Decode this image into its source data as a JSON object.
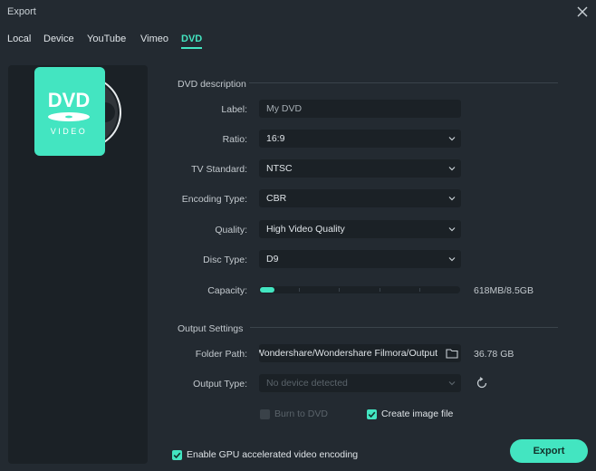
{
  "window": {
    "title": "Export"
  },
  "tabs": [
    {
      "label": "Local"
    },
    {
      "label": "Device"
    },
    {
      "label": "YouTube"
    },
    {
      "label": "Vimeo"
    },
    {
      "label": "DVD"
    }
  ],
  "active_tab": "DVD",
  "preview": {
    "logo_text": "DVD",
    "logo_subtext": "VIDEO"
  },
  "dvd_description": {
    "title": "DVD description",
    "label": {
      "label": "Label:",
      "value": "My DVD"
    },
    "ratio": {
      "label": "Ratio:",
      "value": "16:9"
    },
    "tv_standard": {
      "label": "TV Standard:",
      "value": "NTSC"
    },
    "encoding_type": {
      "label": "Encoding Type:",
      "value": "CBR"
    },
    "quality": {
      "label": "Quality:",
      "value": "High Video Quality"
    },
    "disc_type": {
      "label": "Disc Type:",
      "value": "D9"
    },
    "capacity": {
      "label": "Capacity:",
      "text": "618MB/8.5GB",
      "used_fraction": 0.071
    }
  },
  "output_settings": {
    "title": "Output Settings",
    "folder_path": {
      "label": "Folder Path:",
      "value": "C:/Users/Wondershare/Wondershare Filmora/Output",
      "free_space": "36.78 GB"
    },
    "output_type": {
      "label": "Output Type:",
      "placeholder": "No device detected"
    },
    "burn_to_dvd": {
      "label": "Burn to DVD",
      "checked": false
    },
    "create_image_file": {
      "label": "Create image file",
      "checked": true
    }
  },
  "gpu_encoding": {
    "label": "Enable GPU accelerated video encoding",
    "checked": true
  },
  "export_button": {
    "label": "Export"
  },
  "colors": {
    "accent": "#43e5c1",
    "background": "#232a31",
    "field": "#1b2126"
  }
}
